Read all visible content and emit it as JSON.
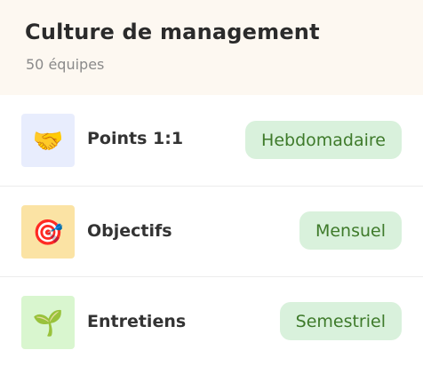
{
  "header": {
    "title": "Culture de management",
    "subtitle": "50 équipes"
  },
  "items": [
    {
      "icon": "handshake-icon",
      "icon_glyph": "🤝",
      "icon_bg": "#e8edfd",
      "label": "Points 1:1",
      "frequency": "Hebdomadaire"
    },
    {
      "icon": "target-icon",
      "icon_glyph": "🎯",
      "icon_bg": "#fbe3a4",
      "label": "Objectifs",
      "frequency": "Mensuel"
    },
    {
      "icon": "seedling-icon",
      "icon_glyph": "🌱",
      "icon_bg": "#d9f6cf",
      "label": "Entretiens",
      "frequency": "Semestriel"
    }
  ],
  "colors": {
    "header_bg": "#fdf8f1",
    "badge_bg": "#d9f1dc",
    "badge_text": "#3e7a2a"
  }
}
